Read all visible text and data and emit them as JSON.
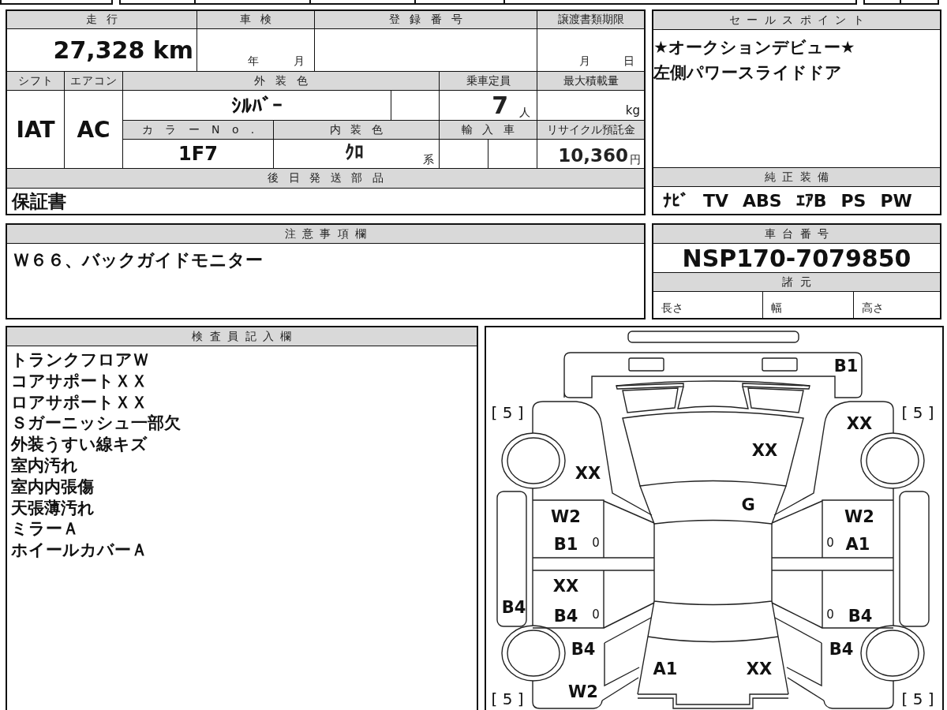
{
  "vehicle_form": {
    "mileage": {
      "label": "走行",
      "value": "27,328 km"
    },
    "inspection": {
      "label": "車検",
      "year_unit": "年",
      "month_unit": "月"
    },
    "registration_number": {
      "label": "登録番号"
    },
    "transfer_deadline": {
      "label": "譲渡書類期限",
      "month_unit": "月",
      "day_unit": "日"
    },
    "shift": {
      "label": "シフト",
      "value": "IAT"
    },
    "air_conditioner": {
      "label": "エアコン",
      "value": "AC"
    },
    "exterior_color": {
      "label": "外装色",
      "value": "ｼﾙﾊﾞｰ"
    },
    "seating_capacity": {
      "label": "乗車定員",
      "value": "7",
      "unit": "人"
    },
    "max_load": {
      "label": "最大積載量",
      "unit": "kg"
    },
    "color_number": {
      "label": "カラーNo.",
      "value": "1F7"
    },
    "interior_color": {
      "label": "内装色",
      "value": "ｸﾛ",
      "suffix": "系"
    },
    "imported": {
      "label": "輸入車"
    },
    "recycling_deposit": {
      "label": "リサイクル預託金",
      "value": "10,360",
      "unit": "円"
    },
    "parts_sent_later": {
      "label": "後日発送部品",
      "value": "保証書"
    }
  },
  "sales_points": {
    "title": "セールスポイント",
    "lines": [
      "★オークションデビュー★",
      "左側パワースライドドア"
    ]
  },
  "factory_equipment": {
    "title": "純正装備",
    "items": [
      "ﾅﾋﾞ",
      "TV",
      "ABS",
      "ｴｱB",
      "PS",
      "PW"
    ]
  },
  "notes": {
    "title": "注意事項欄",
    "text": "Ｗ６６、バックガイドモニター"
  },
  "chassis": {
    "title": "車台番号",
    "number": "NSP170-7079850",
    "specs_title": "諸元",
    "specs": [
      "長さ",
      "幅",
      "高さ"
    ]
  },
  "inspector_notes": {
    "title": "検査員記入欄",
    "lines": [
      "トランクフロアＷ",
      "コアサポートＸＸ",
      "ロアサポートＸＸ",
      "Ｓガーニッシュ一部欠",
      "外装うすい線キズ",
      "室内汚れ",
      "室内内張傷",
      "天張薄汚れ",
      "ミラーＡ",
      "ホイールカバーＡ"
    ]
  },
  "diagram": {
    "tire_treads": {
      "left_front": "[ 5 ]",
      "right_front": "[ 5 ]",
      "left_rear": "[ 5 ]",
      "right_rear": "[ 5 ]"
    },
    "damage": {
      "front_bumper": [
        "B1"
      ],
      "right_front_fender": [
        "XX"
      ],
      "hood": [
        "XX"
      ],
      "left_front_fender": [
        "XX"
      ],
      "windshield": [
        "G"
      ],
      "left_front_door": [
        "W2",
        "B1"
      ],
      "right_front_door": [
        "W2",
        "A1"
      ],
      "left_rear_door": [
        "XX",
        "B4"
      ],
      "left_sill": [
        "B4"
      ],
      "right_rear_door": [
        "B4"
      ],
      "left_rear_quarter": [
        "B4",
        "W2"
      ],
      "right_rear_quarter": [
        "B4"
      ],
      "back_door": [
        "A1",
        "XX"
      ]
    },
    "door_marks": {
      "left_front_door": "0",
      "right_front_door": "0",
      "left_rear_door": "0",
      "right_rear_door": "0"
    }
  }
}
